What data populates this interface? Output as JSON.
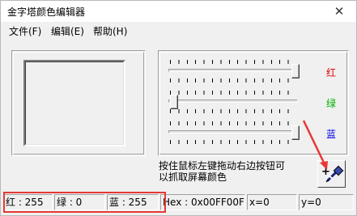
{
  "window": {
    "title": "金字塔颜色编辑器",
    "close_glyph": "✕"
  },
  "menu": {
    "items": [
      {
        "label": "文件(F)"
      },
      {
        "label": "编辑(E)"
      },
      {
        "label": "帮助(H)"
      }
    ]
  },
  "sliders": {
    "red": {
      "label": "红",
      "value": 255,
      "max": 255,
      "color": "#e00000"
    },
    "green": {
      "label": "绿",
      "value": 0,
      "max": 255,
      "color": "#00b000"
    },
    "blue": {
      "label": "蓝",
      "value": 255,
      "max": 255,
      "color": "#0000e0"
    }
  },
  "preview": {
    "color": "#f0f0f0"
  },
  "hint": "按住鼠标左键拖动右边按钮可以抓取屏幕颜色",
  "pick_button": {
    "icon": "eyedropper-icon",
    "glyph": "+"
  },
  "status": {
    "red": "红 : 255",
    "green": "绿 : 0",
    "blue": "蓝 : 255",
    "hex": "Hex : 0x00FF00FF",
    "x": "x=0",
    "y": "y=0"
  },
  "annotation": {
    "color": "#e53935"
  }
}
